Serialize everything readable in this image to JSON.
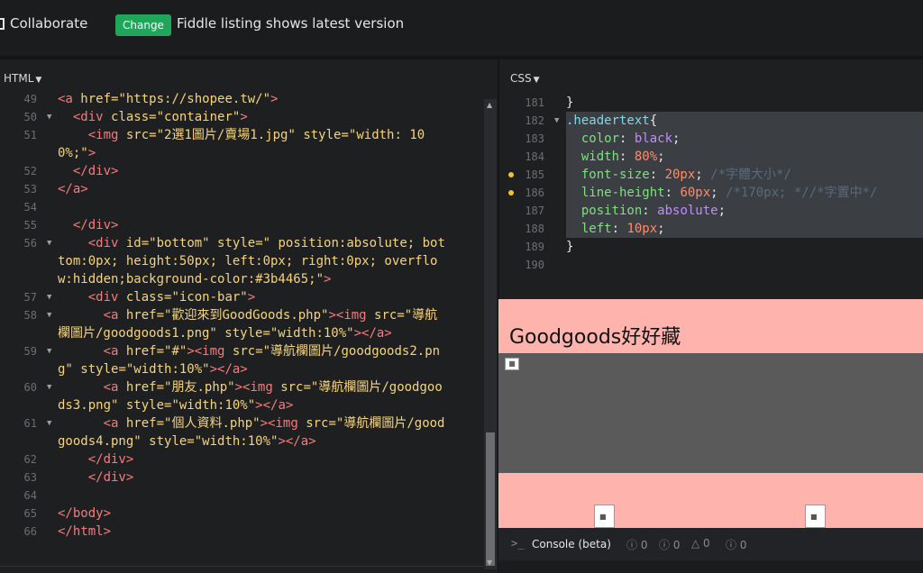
{
  "topbar": {
    "collaborate_label": "Collaborate",
    "change_button": "Change",
    "listing_text": "Fiddle listing shows latest version",
    "accent_color": "#1fa65a"
  },
  "html_panel": {
    "label": "HTML",
    "lines": [
      {
        "num": "49",
        "fold": false,
        "parts": [
          [
            "t",
            "<a "
          ],
          [
            "a",
            "href="
          ],
          [
            "s",
            "\"https://shopee.tw/\""
          ],
          [
            "t",
            ">"
          ]
        ]
      },
      {
        "num": "50",
        "fold": true,
        "parts": [
          [
            "p",
            "  "
          ],
          [
            "t",
            "<div "
          ],
          [
            "a",
            "class="
          ],
          [
            "s",
            "\"container\""
          ],
          [
            "t",
            ">"
          ]
        ]
      },
      {
        "num": "51",
        "fold": false,
        "parts": [
          [
            "p",
            "    "
          ],
          [
            "t",
            "<img "
          ],
          [
            "a",
            "src="
          ],
          [
            "s",
            "\"2選1圖片/賣場1.jpg\""
          ],
          [
            "p",
            " "
          ],
          [
            "a",
            "style="
          ],
          [
            "s",
            "\"width: 10"
          ]
        ]
      },
      {
        "num": "",
        "fold": false,
        "parts": [
          [
            "s",
            "0%;\""
          ],
          [
            "t",
            ">"
          ]
        ]
      },
      {
        "num": "52",
        "fold": false,
        "parts": [
          [
            "p",
            "  "
          ],
          [
            "t",
            "</div>"
          ]
        ]
      },
      {
        "num": "53",
        "fold": false,
        "parts": [
          [
            "t",
            "</a>"
          ]
        ]
      },
      {
        "num": "54",
        "fold": false,
        "parts": []
      },
      {
        "num": "55",
        "fold": false,
        "parts": [
          [
            "p",
            "  "
          ],
          [
            "t",
            "</div>"
          ]
        ]
      },
      {
        "num": "56",
        "fold": true,
        "parts": [
          [
            "p",
            "    "
          ],
          [
            "t",
            "<div "
          ],
          [
            "a",
            "id="
          ],
          [
            "s",
            "\"bottom\""
          ],
          [
            "p",
            " "
          ],
          [
            "a",
            "style="
          ],
          [
            "s",
            "\" position:absolute; bot"
          ]
        ]
      },
      {
        "num": "",
        "fold": false,
        "parts": [
          [
            "s",
            "tom:0px; height:50px; left:0px; right:0px; overflo"
          ]
        ]
      },
      {
        "num": "",
        "fold": false,
        "parts": [
          [
            "s",
            "w:hidden;background-color:#3b4465;\""
          ],
          [
            "t",
            ">"
          ]
        ]
      },
      {
        "num": "57",
        "fold": true,
        "parts": [
          [
            "p",
            "    "
          ],
          [
            "t",
            "<div "
          ],
          [
            "a",
            "class="
          ],
          [
            "s",
            "\"icon-bar\""
          ],
          [
            "t",
            ">"
          ]
        ]
      },
      {
        "num": "58",
        "fold": true,
        "parts": [
          [
            "p",
            "      "
          ],
          [
            "t",
            "<a "
          ],
          [
            "a",
            "href="
          ],
          [
            "s",
            "\"歡迎來到GoodGoods.php\""
          ],
          [
            "t",
            "><img "
          ],
          [
            "a",
            "src="
          ],
          [
            "s",
            "\"導航"
          ]
        ]
      },
      {
        "num": "",
        "fold": false,
        "parts": [
          [
            "s",
            "欄圖片/goodgoods1.png\""
          ],
          [
            "p",
            " "
          ],
          [
            "a",
            "style="
          ],
          [
            "s",
            "\"width:10%\""
          ],
          [
            "t",
            "></a>"
          ]
        ]
      },
      {
        "num": "59",
        "fold": true,
        "parts": [
          [
            "p",
            "      "
          ],
          [
            "t",
            "<a "
          ],
          [
            "a",
            "href="
          ],
          [
            "s",
            "\"#\""
          ],
          [
            "t",
            "><img "
          ],
          [
            "a",
            "src="
          ],
          [
            "s",
            "\"導航欄圖片/goodgoods2.pn"
          ]
        ]
      },
      {
        "num": "",
        "fold": false,
        "parts": [
          [
            "s",
            "g\""
          ],
          [
            "p",
            " "
          ],
          [
            "a",
            "style="
          ],
          [
            "s",
            "\"width:10%\""
          ],
          [
            "t",
            "></a>"
          ]
        ]
      },
      {
        "num": "60",
        "fold": true,
        "parts": [
          [
            "p",
            "      "
          ],
          [
            "t",
            "<a "
          ],
          [
            "a",
            "href="
          ],
          [
            "s",
            "\"朋友.php\""
          ],
          [
            "t",
            "><img "
          ],
          [
            "a",
            "src="
          ],
          [
            "s",
            "\"導航欄圖片/goodgoo"
          ]
        ]
      },
      {
        "num": "",
        "fold": false,
        "parts": [
          [
            "s",
            "ds3.png\""
          ],
          [
            "p",
            " "
          ],
          [
            "a",
            "style="
          ],
          [
            "s",
            "\"width:10%\""
          ],
          [
            "t",
            "></a>"
          ]
        ]
      },
      {
        "num": "61",
        "fold": true,
        "parts": [
          [
            "p",
            "      "
          ],
          [
            "t",
            "<a "
          ],
          [
            "a",
            "href="
          ],
          [
            "s",
            "\"個人資料.php\""
          ],
          [
            "t",
            "><img "
          ],
          [
            "a",
            "src="
          ],
          [
            "s",
            "\"導航欄圖片/good"
          ]
        ]
      },
      {
        "num": "",
        "fold": false,
        "parts": [
          [
            "s",
            "goods4.png\""
          ],
          [
            "p",
            " "
          ],
          [
            "a",
            "style="
          ],
          [
            "s",
            "\"width:10%\""
          ],
          [
            "t",
            "></a>"
          ]
        ]
      },
      {
        "num": "62",
        "fold": false,
        "parts": [
          [
            "p",
            "    "
          ],
          [
            "t",
            "</div>"
          ]
        ]
      },
      {
        "num": "63",
        "fold": false,
        "parts": [
          [
            "p",
            "    "
          ],
          [
            "t",
            "</div>"
          ]
        ]
      },
      {
        "num": "64",
        "fold": false,
        "parts": []
      },
      {
        "num": "65",
        "fold": false,
        "parts": [
          [
            "t",
            "</body>"
          ]
        ]
      },
      {
        "num": "66",
        "fold": false,
        "parts": [
          [
            "t",
            "</html>"
          ]
        ]
      }
    ]
  },
  "css_panel": {
    "label": "CSS",
    "lines": [
      {
        "num": "181",
        "fold": false,
        "dot": false,
        "parts": [
          [
            "p",
            "}"
          ]
        ]
      },
      {
        "num": "182",
        "fold": true,
        "dot": false,
        "parts": [
          [
            "selx",
            ".headertext"
          ],
          [
            "p",
            "{"
          ]
        ]
      },
      {
        "num": "183",
        "fold": false,
        "dot": false,
        "parts": [
          [
            "p",
            "  "
          ],
          [
            "prop",
            "color"
          ],
          [
            "p",
            ": "
          ],
          [
            "val",
            "black"
          ],
          [
            "p",
            ";"
          ]
        ]
      },
      {
        "num": "184",
        "fold": false,
        "dot": false,
        "parts": [
          [
            "p",
            "  "
          ],
          [
            "prop",
            "width"
          ],
          [
            "p",
            ": "
          ],
          [
            "num",
            "80%"
          ],
          [
            "p",
            ";"
          ]
        ]
      },
      {
        "num": "185",
        "fold": false,
        "dot": true,
        "parts": [
          [
            "p",
            "  "
          ],
          [
            "prop",
            "font-size"
          ],
          [
            "p",
            ": "
          ],
          [
            "num",
            "20px"
          ],
          [
            "p",
            "; "
          ],
          [
            "cmt",
            "/*字體大小*/"
          ]
        ]
      },
      {
        "num": "186",
        "fold": false,
        "dot": true,
        "parts": [
          [
            "p",
            "  "
          ],
          [
            "prop",
            "line-height"
          ],
          [
            "p",
            ": "
          ],
          [
            "num",
            "60px"
          ],
          [
            "p",
            "; "
          ],
          [
            "cmt",
            "/*170px; *//*字置中*/"
          ]
        ]
      },
      {
        "num": "187",
        "fold": false,
        "dot": false,
        "parts": [
          [
            "p",
            "  "
          ],
          [
            "prop",
            "position"
          ],
          [
            "p",
            ": "
          ],
          [
            "val",
            "absolute"
          ],
          [
            "p",
            ";"
          ]
        ]
      },
      {
        "num": "188",
        "fold": false,
        "dot": false,
        "parts": [
          [
            "p",
            "  "
          ],
          [
            "prop",
            "left"
          ],
          [
            "p",
            ": "
          ],
          [
            "num",
            "10px"
          ],
          [
            "p",
            ";"
          ]
        ]
      },
      {
        "num": "189",
        "fold": false,
        "dot": false,
        "parts": [
          [
            "p",
            "}"
          ]
        ]
      },
      {
        "num": "190",
        "fold": false,
        "dot": false,
        "parts": []
      }
    ]
  },
  "preview": {
    "header_text": "Goodgoods好好藏",
    "background": "#ffb3ad"
  },
  "console": {
    "prompt_icon": "terminal-icon",
    "label": "Console (beta)",
    "counts": [
      "0",
      "0",
      "0",
      "0"
    ]
  }
}
